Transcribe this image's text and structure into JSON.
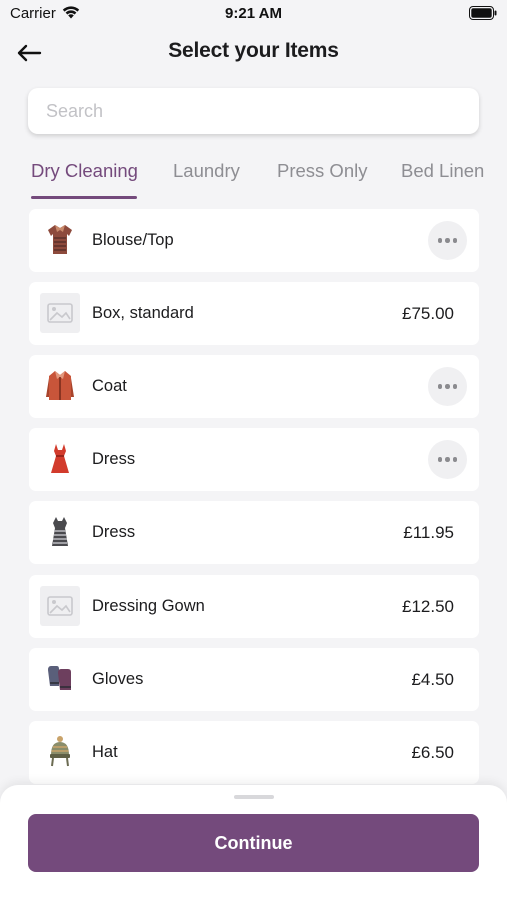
{
  "status_bar": {
    "carrier": "Carrier",
    "time": "9:21 AM"
  },
  "header": {
    "title": "Select your Items",
    "back_icon": "arrow-left-icon"
  },
  "search": {
    "placeholder": "Search",
    "value": ""
  },
  "tabs": [
    {
      "label": "Dry Cleaning",
      "active": true
    },
    {
      "label": "Laundry",
      "active": false
    },
    {
      "label": "Press Only",
      "active": false
    },
    {
      "label": "Bed Linen",
      "active": false
    }
  ],
  "items": [
    {
      "name": "Blouse/Top",
      "price": "",
      "icon": "blouse-icon",
      "has_options": true
    },
    {
      "name": "Box, standard",
      "price": "£75.00",
      "icon": "image-placeholder-icon",
      "has_options": false
    },
    {
      "name": "Coat",
      "price": "",
      "icon": "coat-icon",
      "has_options": true
    },
    {
      "name": "Dress",
      "price": "",
      "icon": "dress-icon",
      "has_options": true
    },
    {
      "name": "Dress",
      "price": "£11.95",
      "icon": "dress-striped-icon",
      "has_options": false
    },
    {
      "name": "Dressing Gown",
      "price": "£12.50",
      "icon": "image-placeholder-icon",
      "has_options": false
    },
    {
      "name": "Gloves",
      "price": "£4.50",
      "icon": "gloves-icon",
      "has_options": false
    },
    {
      "name": "Hat",
      "price": "£6.50",
      "icon": "hat-icon",
      "has_options": false
    }
  ],
  "footer": {
    "continue_label": "Continue"
  },
  "colors": {
    "accent": "#744a7c",
    "background": "#f4f4f6",
    "card": "#ffffff"
  }
}
